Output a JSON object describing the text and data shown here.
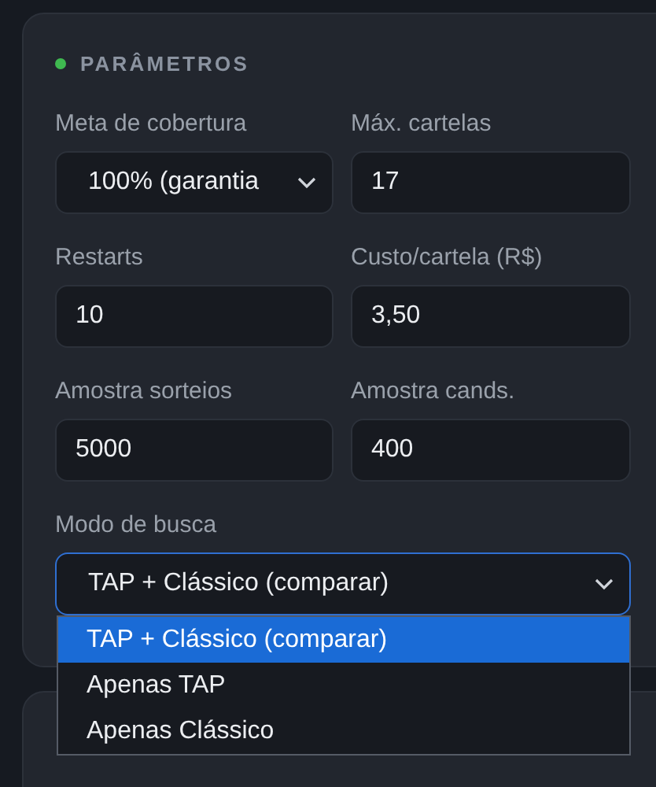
{
  "panel": {
    "title": "PARÂMETROS",
    "fields": [
      {
        "label": "Meta de cobertura",
        "kind": "select",
        "value": "100% (garantia"
      },
      {
        "label": "Máx. cartelas",
        "kind": "input",
        "value": "17"
      },
      {
        "label": "Restarts",
        "kind": "input",
        "value": "10"
      },
      {
        "label": "Custo/cartela (R$)",
        "kind": "input",
        "value": "3,50"
      },
      {
        "label": "Amostra sorteios",
        "kind": "input",
        "value": "5000"
      },
      {
        "label": "Amostra cands.",
        "kind": "input",
        "value": "400"
      }
    ],
    "search_mode": {
      "label": "Modo de busca",
      "value": "TAP + Clássico (comparar)",
      "expanded": true,
      "options": [
        {
          "label": "TAP + Clássico (comparar)",
          "selected": true
        },
        {
          "label": "Apenas TAP",
          "selected": false
        },
        {
          "label": "Apenas Clássico",
          "selected": false
        }
      ]
    }
  }
}
